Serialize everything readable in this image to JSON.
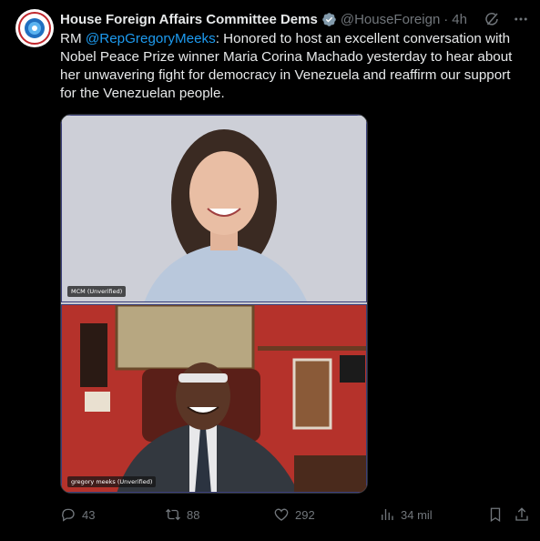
{
  "header": {
    "display_name": "House Foreign Affairs Committee Dems",
    "handle": "@HouseForeign",
    "separator": "·",
    "time": "4h",
    "avatar_icon": "committee-seal-icon",
    "verified_icon": "verified-badge-icon"
  },
  "tweet": {
    "prefix": "RM ",
    "mention": "@RepGregoryMeeks",
    "body": ": Honored to host an excellent conversation with Nobel Peace Prize winner Maria Corina Machado yesterday to hear about her unwavering fight for democracy in Venezuela and reaffirm our support for the Venezuelan people."
  },
  "media": {
    "top_label": "MCM (Unverified)",
    "bottom_label": "gregory meeks (Unverified)"
  },
  "actions": {
    "replies": "43",
    "reposts": "88",
    "likes": "292",
    "views": "34 mil"
  },
  "colors": {
    "background": "#000000",
    "text": "#e7e9ea",
    "muted": "#71767b",
    "link": "#1d9bf0",
    "verified": "#829aab"
  }
}
